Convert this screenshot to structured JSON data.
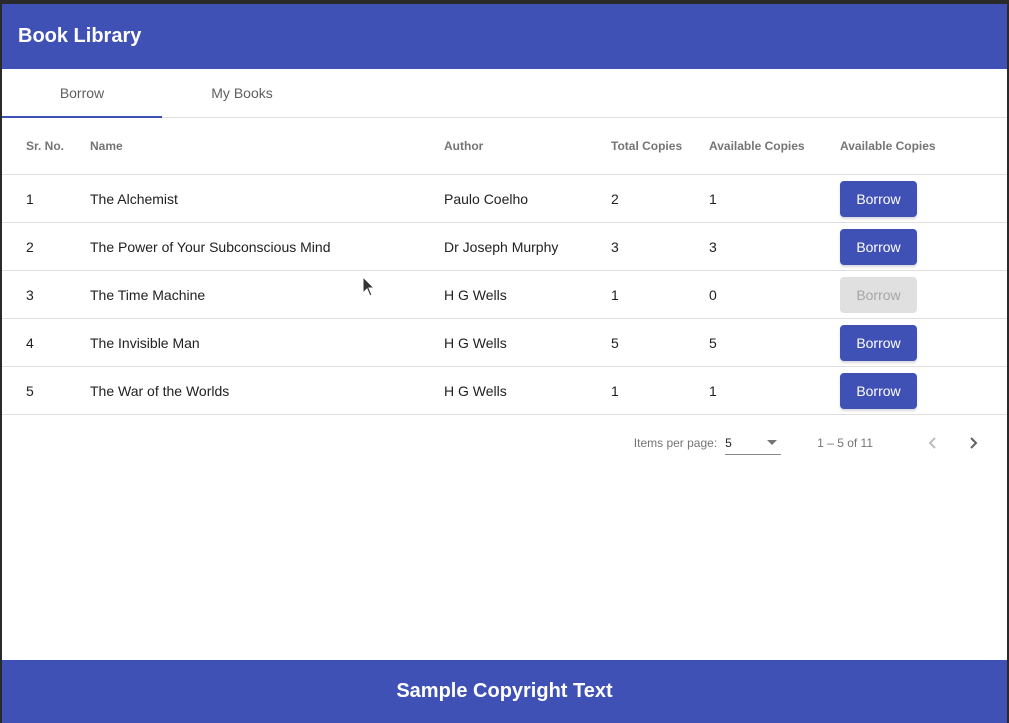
{
  "app": {
    "title": "Book Library"
  },
  "tabs": [
    {
      "label": "Borrow",
      "active": true
    },
    {
      "label": "My Books",
      "active": false
    }
  ],
  "table": {
    "headers": [
      "Sr. No.",
      "Name",
      "Author",
      "Total Copies",
      "Available Copies",
      "Available Copies"
    ],
    "rows": [
      {
        "sr": "1",
        "name": "The Alchemist",
        "author": "Paulo Coelho",
        "total": "2",
        "available": "1",
        "action": "Borrow",
        "enabled": true
      },
      {
        "sr": "2",
        "name": "The Power of Your Subconscious Mind",
        "author": "Dr Joseph Murphy",
        "total": "3",
        "available": "3",
        "action": "Borrow",
        "enabled": true
      },
      {
        "sr": "3",
        "name": "The Time Machine",
        "author": "H G Wells",
        "total": "1",
        "available": "0",
        "action": "Borrow",
        "enabled": false
      },
      {
        "sr": "4",
        "name": "The Invisible Man",
        "author": "H G Wells",
        "total": "5",
        "available": "5",
        "action": "Borrow",
        "enabled": true
      },
      {
        "sr": "5",
        "name": "The War of the Worlds",
        "author": "H G Wells",
        "total": "1",
        "available": "1",
        "action": "Borrow",
        "enabled": true
      }
    ]
  },
  "paginator": {
    "items_per_page_label": "Items per page:",
    "items_per_page_value": "5",
    "range_label": "1 – 5 of 11"
  },
  "footer": {
    "text": "Sample Copyright Text"
  },
  "colors": {
    "primary": "#3f51b5",
    "disabled_bg": "#e0e0e0",
    "disabled_text": "#a6a6a6"
  }
}
